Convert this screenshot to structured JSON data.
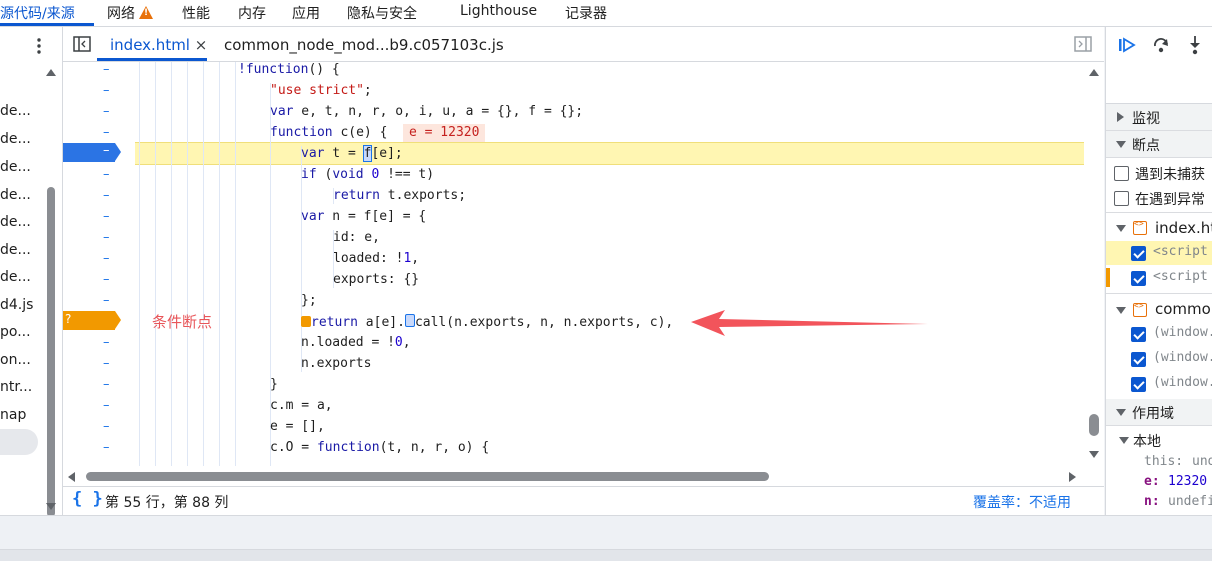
{
  "top_tabs": [
    {
      "label": "源代码/来源",
      "active": true
    },
    {
      "label": "网络",
      "warning": true
    },
    {
      "label": "性能"
    },
    {
      "label": "内存"
    },
    {
      "label": "应用"
    },
    {
      "label": "隐私与安全"
    },
    {
      "label": "Lighthouse"
    },
    {
      "label": "记录器"
    }
  ],
  "navigator": {
    "items": [
      "de...",
      "de...",
      "de...",
      "de...",
      "de...",
      "de...",
      "de...",
      "d4.js",
      "po...",
      "on...",
      "ntr...",
      "nap"
    ]
  },
  "editor_tabs": [
    {
      "label": "index.html",
      "active": true,
      "close": "×"
    },
    {
      "label": "common_node_mod...b9.c057103c.js"
    }
  ],
  "gutter": {
    "dash": "–"
  },
  "breakpoints": {
    "active_line_marker": "–",
    "conditional_marker": "?",
    "colors": {
      "active": "#2b74e4",
      "conditional": "#f29900"
    }
  },
  "code_lines": [
    "!function() {",
    "\"use strict\";",
    "var e, t, n, r, o, i, u, a = {}, f = {};",
    "function c(e) {",
    "var t = f[e];",
    "if (void 0 !== t)",
    "return t.exports;",
    "var n = f[e] = {",
    "id: e,",
    "loaded: !1,",
    "exports: {}",
    "};",
    "return a[e].call(n.exports, n, n.exports, c),",
    "n.loaded = !0,",
    "n.exports",
    "}",
    "c.m = a,",
    "e = [],",
    "c.O = function(t, n, r, o) {"
  ],
  "inline_value": "e = 12320",
  "annotation": {
    "label": "条件断点",
    "arrow_color": "#f2545b"
  },
  "status": {
    "cursor": "第 55 行，第 88 列",
    "coverage_label": "覆盖率：",
    "coverage_value": "不适用"
  },
  "right_panel": {
    "watch": "监视",
    "breakpoints": "断点",
    "pause_uncaught": "遇到未捕获",
    "pause_caught": "在遇到异常",
    "files": [
      {
        "name": "index.ht",
        "entries": [
          "<script",
          "<script"
        ]
      },
      {
        "name": "common",
        "entries": [
          "(window.",
          "(window.",
          "(window."
        ]
      }
    ],
    "scope": "作用域",
    "local": "本地",
    "scope_vars": [
      {
        "name": "this:",
        "value": "und"
      },
      {
        "name": "e:",
        "value": "12320"
      },
      {
        "name": "n:",
        "value": "undefi"
      }
    ]
  }
}
